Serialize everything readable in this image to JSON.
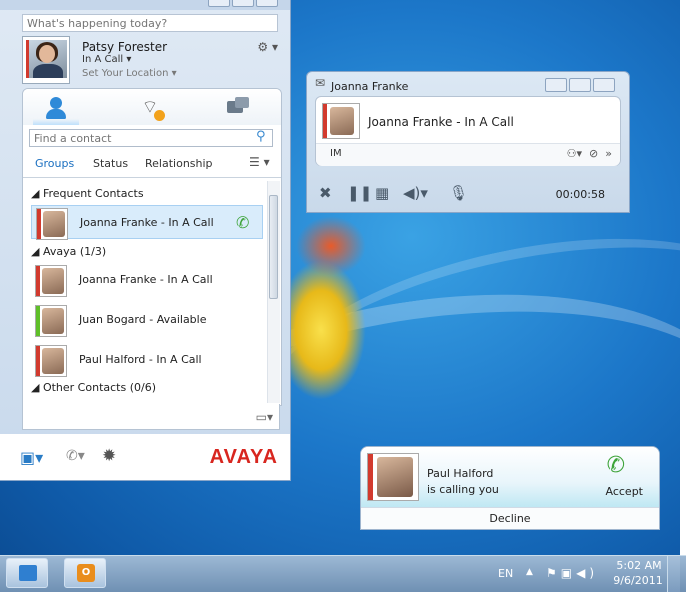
{
  "lync": {
    "status_placeholder": "What's happening today?",
    "me": {
      "name": "Patsy Forester",
      "status": "In A Call ▾",
      "location": "Set Your Location ▾"
    },
    "find_placeholder": "Find a contact",
    "group_tabs": {
      "groups": "Groups",
      "status": "Status",
      "relationship": "Relationship"
    },
    "groups": [
      {
        "header": "◢ Frequent Contacts",
        "contacts": [
          {
            "label": "Joanna Franke - In A Call",
            "presence": "busy"
          }
        ]
      },
      {
        "header": "◢ Avaya (1/3)",
        "contacts": [
          {
            "label": "Joanna Franke - In A Call",
            "presence": "busy"
          },
          {
            "label": "Juan Bogard - Available",
            "presence": "available"
          },
          {
            "label": "Paul Halford - In A Call",
            "presence": "busy"
          }
        ]
      },
      {
        "header": "◢ Other Contacts (0/6)",
        "contacts": []
      }
    ],
    "brand": "AVAYA"
  },
  "conversation": {
    "title": "Joanna Franke",
    "contact_line": "Joanna Franke - In A Call",
    "im_label": "IM",
    "timer": "00:00:58"
  },
  "toast": {
    "caller": "Paul Halford",
    "message": "is calling you",
    "accept": "Accept",
    "decline": "Decline"
  },
  "taskbar": {
    "language": "EN",
    "time": "5:02 AM",
    "date": "9/6/2011"
  },
  "colors": {
    "brand_red": "#d8261f",
    "presence_busy": "#d23a2e",
    "presence_available": "#5fbf28",
    "call_green": "#3ea43a",
    "desktop_blue": "#1c77c9"
  },
  "icons": [
    "search-icon",
    "contacts-icon",
    "activity-feed-icon",
    "conversations-icon",
    "layout-options-icon",
    "phone-icon",
    "gear-icon",
    "monitor-icon",
    "microphone-icon",
    "speaker-icon",
    "pause-icon",
    "dialpad-icon",
    "end-call-icon",
    "paperclip-icon"
  ]
}
